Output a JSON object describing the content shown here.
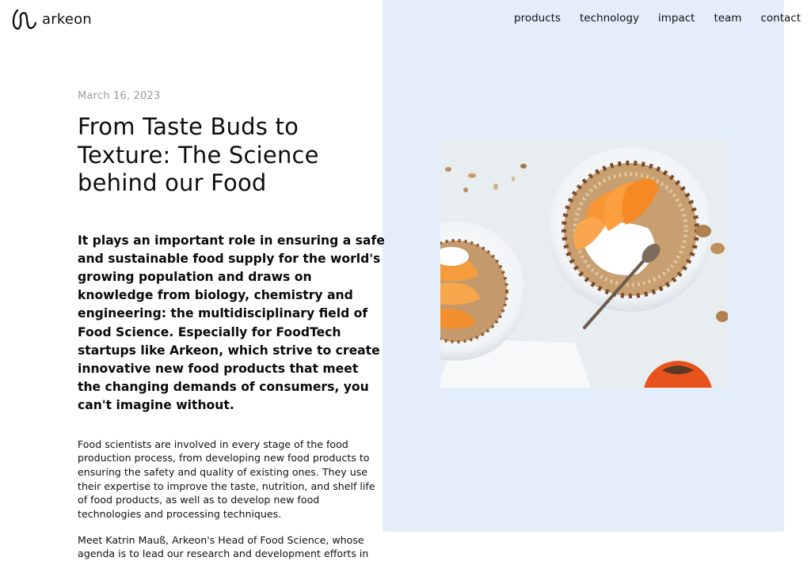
{
  "brand": {
    "name": "arkeon"
  },
  "nav": {
    "items": [
      "products",
      "technology",
      "impact",
      "team",
      "contact"
    ]
  },
  "article": {
    "date": "March 16, 2023",
    "title": "From Taste Buds to Texture: The Science behind our Food",
    "lead": "It plays an important role in ensuring a safe and sustainable food supply for the world's growing population and draws on knowledge from biology, chemistry and engineering: the multidisciplinary field of Food Science. Especially for FoodTech startups like Arkeon, which strive to create innovative new food products that meet the changing demands of consumers, you can't imagine without.",
    "paragraphs": [
      "Food scientists are involved in every stage of the food production process, from developing new food products to ensuring the safety and quality of existing ones. They use their expertise to improve the taste, nutrition, and shelf life of food products, as well as to develop new food technologies and processing techniques.",
      "Meet Katrin Mauß, Arkeon's Head of Food Science, whose agenda is to lead our research and development efforts in"
    ]
  },
  "colors": {
    "panel_background": "#e3eefa",
    "date_text": "#9b9b9b"
  }
}
